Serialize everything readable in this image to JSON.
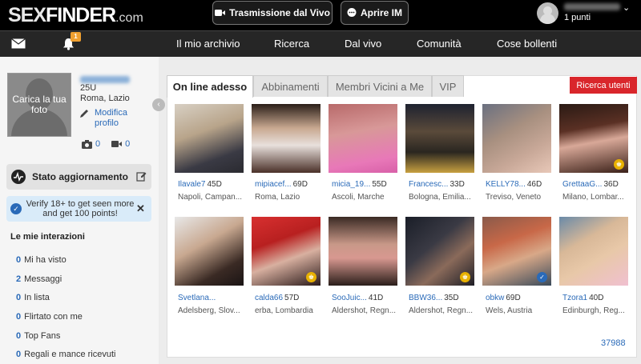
{
  "header": {
    "logo": {
      "sex": "SEX",
      "finder": "FINDER",
      "com": ".com"
    },
    "live_button": "Trasmissione dal Vivo",
    "im_button": "Aprire IM",
    "user_points": "1 punti"
  },
  "nav": {
    "notification_count": "1",
    "items": [
      "Il mio archivio",
      "Ricerca",
      "Dal vivo",
      "Comunità",
      "Cose bollenti"
    ]
  },
  "profile": {
    "photo_prompt": "Carica la tua foto",
    "age_gender": "25U",
    "location": "Roma, Lazio",
    "edit_link": "Modifica profilo",
    "photo_count": "0",
    "video_count": "0"
  },
  "status": {
    "title": "Stato aggiornamento"
  },
  "verify": {
    "text": "Verify 18+ to get seen more and get 100 points!"
  },
  "interactions": {
    "title": "Le mie interazioni",
    "items": [
      {
        "count": "0",
        "label": "Mi ha visto"
      },
      {
        "count": "2",
        "label": "Messaggi"
      },
      {
        "count": "0",
        "label": "In lista"
      },
      {
        "count": "0",
        "label": "Flirtato con me"
      },
      {
        "count": "0",
        "label": "Top Fans"
      },
      {
        "count": "0",
        "label": "Regali e mance ricevuti"
      }
    ]
  },
  "tabs": [
    "On line adesso",
    "Abbinamenti",
    "Membri Vicini a Me",
    "VIP"
  ],
  "search_button": "Ricerca utenti",
  "members": [
    {
      "name": "Ilavale7",
      "age": "45D",
      "location": "Napoli, Campan..."
    },
    {
      "name": "mipiacef...",
      "age": "69D",
      "location": "Roma, Lazio"
    },
    {
      "name": "micia_19...",
      "age": "55D",
      "location": "Ascoli, Marche"
    },
    {
      "name": "Francesc...",
      "age": "33D",
      "location": "Bologna, Emilia..."
    },
    {
      "name": "KELLY78...",
      "age": "46D",
      "location": "Treviso, Veneto"
    },
    {
      "name": "GrettaaG...",
      "age": "36D",
      "location": "Milano, Lombar..."
    },
    {
      "name": "Svetlana...",
      "age": "",
      "location": "Adelsberg, Slov..."
    },
    {
      "name": "calda66",
      "age": "57D",
      "location": "erba, Lombardia"
    },
    {
      "name": "SooJuic...",
      "age": "41D",
      "location": "Aldershot, Regn..."
    },
    {
      "name": "BBW36...",
      "age": "35D",
      "location": "Aldershot, Regn..."
    },
    {
      "name": "obkw",
      "age": "69D",
      "location": "Wels, Austria"
    },
    {
      "name": "Tzora1",
      "age": "40D",
      "location": "Edinburgh, Reg..."
    }
  ],
  "total_members": "37988",
  "colors": {
    "accent_blue": "#2a6ab8",
    "search_red": "#d9262b",
    "badge_orange": "#f0a030",
    "crown_gold": "#e8b100"
  }
}
